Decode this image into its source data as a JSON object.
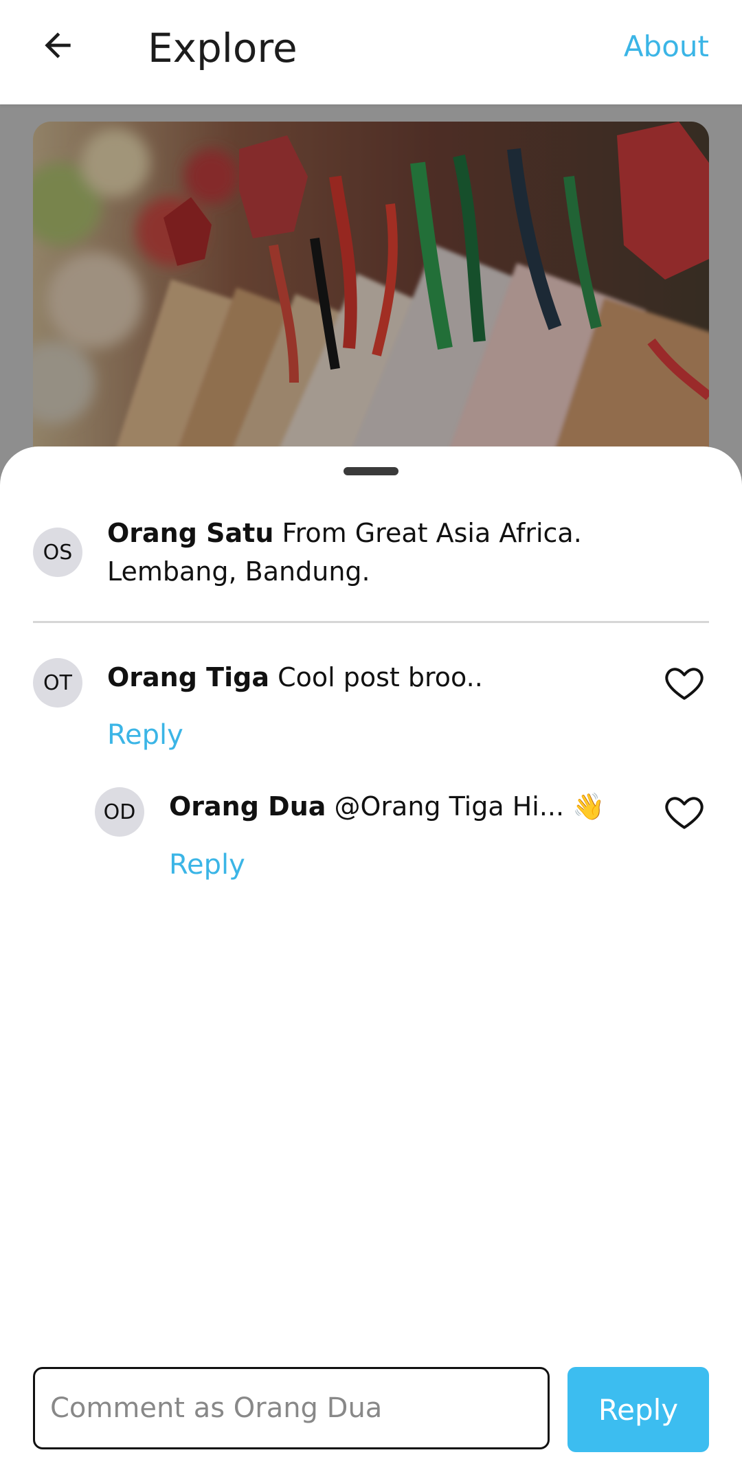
{
  "header": {
    "title": "Explore",
    "about_label": "About"
  },
  "post": {
    "image_subject": "wooden-ema-prayer-plaques-with-colored-ropes"
  },
  "caption": {
    "avatar_initials": "OS",
    "author": "Orang Satu",
    "text": "From Great Asia Africa. Lembang, Bandung."
  },
  "comments": [
    {
      "avatar_initials": "OT",
      "author": "Orang Tiga",
      "text": "Cool post broo..",
      "reply_label": "Reply"
    },
    {
      "avatar_initials": "OD",
      "author": "Orang Dua",
      "text": "@Orang Tiga Hi... 👋",
      "reply_label": "Reply"
    }
  ],
  "composer": {
    "placeholder": "Comment as Orang Dua",
    "value": "",
    "send_label": "Reply"
  },
  "colors": {
    "accent": "#3bb5e6",
    "button": "#3cbdf0"
  }
}
